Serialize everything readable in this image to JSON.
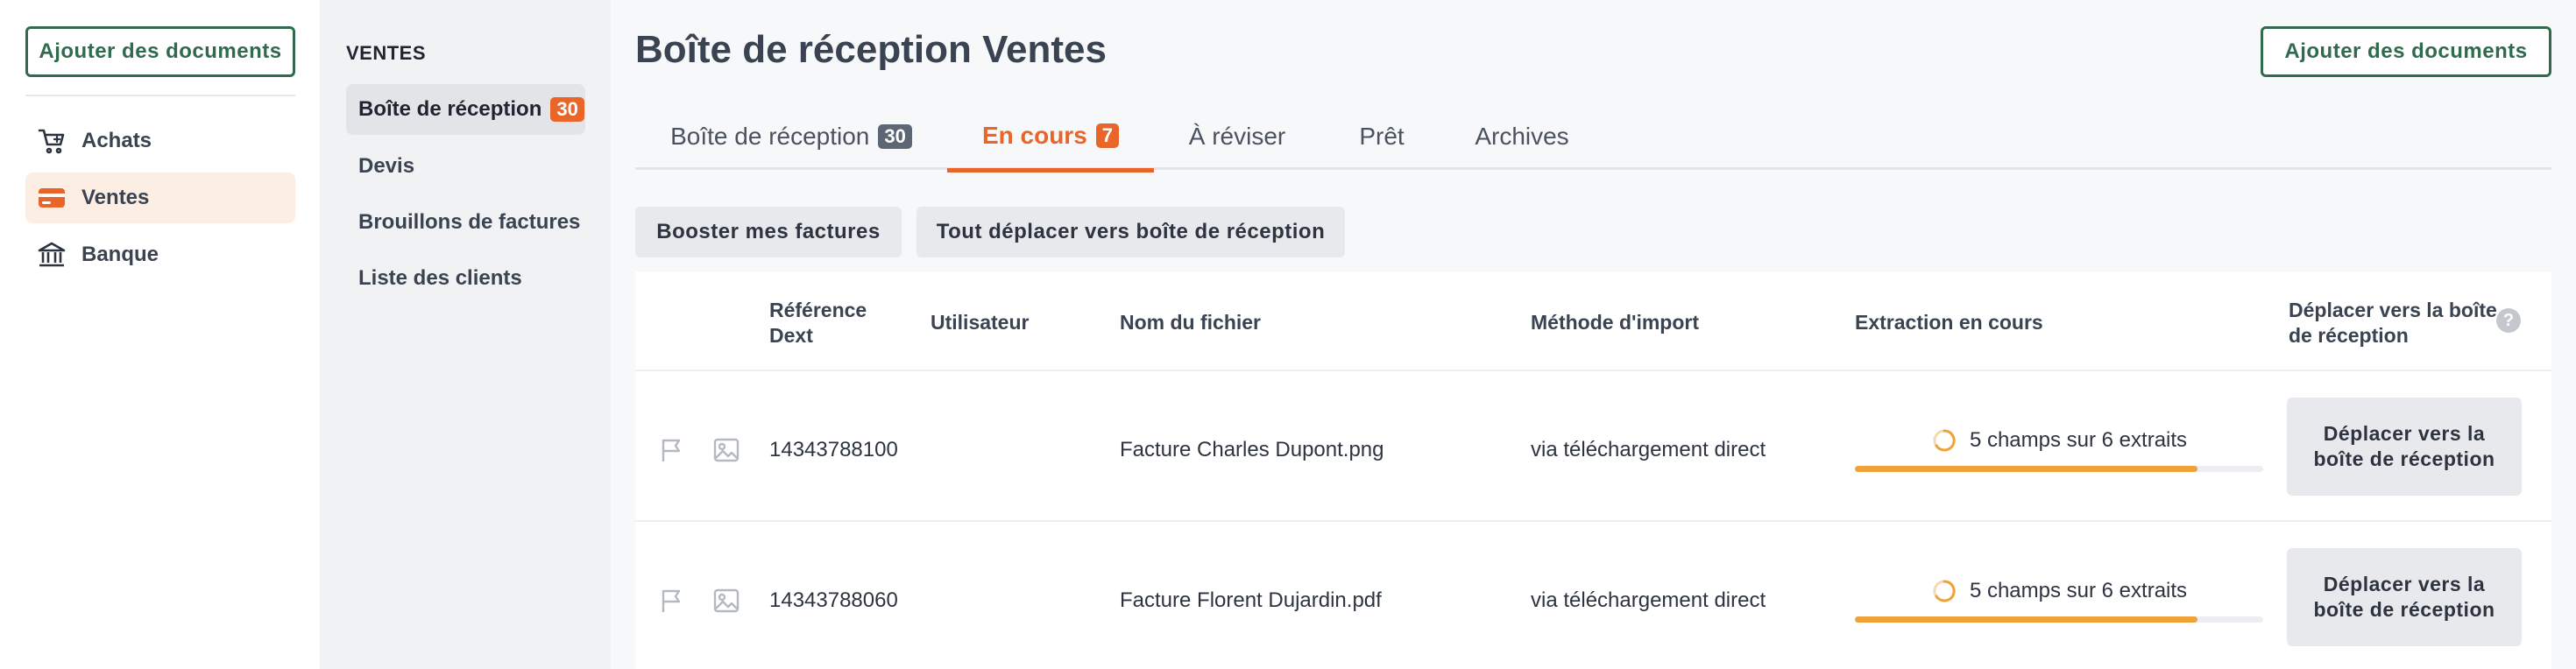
{
  "left_nav": {
    "add_label": "Ajouter des documents",
    "items": [
      {
        "label": "Achats",
        "icon": "cart-icon",
        "active": false
      },
      {
        "label": "Ventes",
        "icon": "card-icon",
        "active": true
      },
      {
        "label": "Banque",
        "icon": "bank-icon",
        "active": false
      }
    ]
  },
  "sub_nav": {
    "section_title": "VENTES",
    "items": [
      {
        "label": "Boîte de réception",
        "badge": "30",
        "active": true
      },
      {
        "label": "Devis"
      },
      {
        "label": "Brouillons de factures"
      },
      {
        "label": "Liste des clients"
      }
    ]
  },
  "main": {
    "title": "Boîte de réception Ventes",
    "add_label": "Ajouter des documents",
    "tabs": [
      {
        "label": "Boîte de réception",
        "badge": "30",
        "active": false
      },
      {
        "label": "En cours",
        "badge": "7",
        "active": true
      },
      {
        "label": "À réviser"
      },
      {
        "label": "Prêt"
      },
      {
        "label": "Archives"
      }
    ],
    "actions": {
      "boost_label": "Booster mes factures",
      "move_all_label": "Tout déplacer vers boîte de réception"
    },
    "table": {
      "headers": {
        "ref": "Référence Dext",
        "user": "Utilisateur",
        "file": "Nom du fichier",
        "import": "Méthode d'import",
        "extraction": "Extraction en cours",
        "move": "Déplacer vers la boîte de réception"
      },
      "rows": [
        {
          "ref": "14343788100",
          "user": "",
          "file": "Facture Charles Dupont.png",
          "import": "via téléchargement direct",
          "extraction_label": "5 champs sur 6 extraits",
          "progress": 0.84,
          "move_label": "Déplacer vers la boîte de réception"
        },
        {
          "ref": "14343788060",
          "user": "",
          "file": "Facture Florent Dujardin.pdf",
          "import": "via téléchargement direct",
          "extraction_label": "5 champs sur 6 extraits",
          "progress": 0.84,
          "move_label": "Déplacer vers la boîte de réception"
        }
      ]
    }
  },
  "colors": {
    "accent": "#e9652a",
    "brand_green": "#2f6b4c",
    "progress": "#f0a23a"
  }
}
